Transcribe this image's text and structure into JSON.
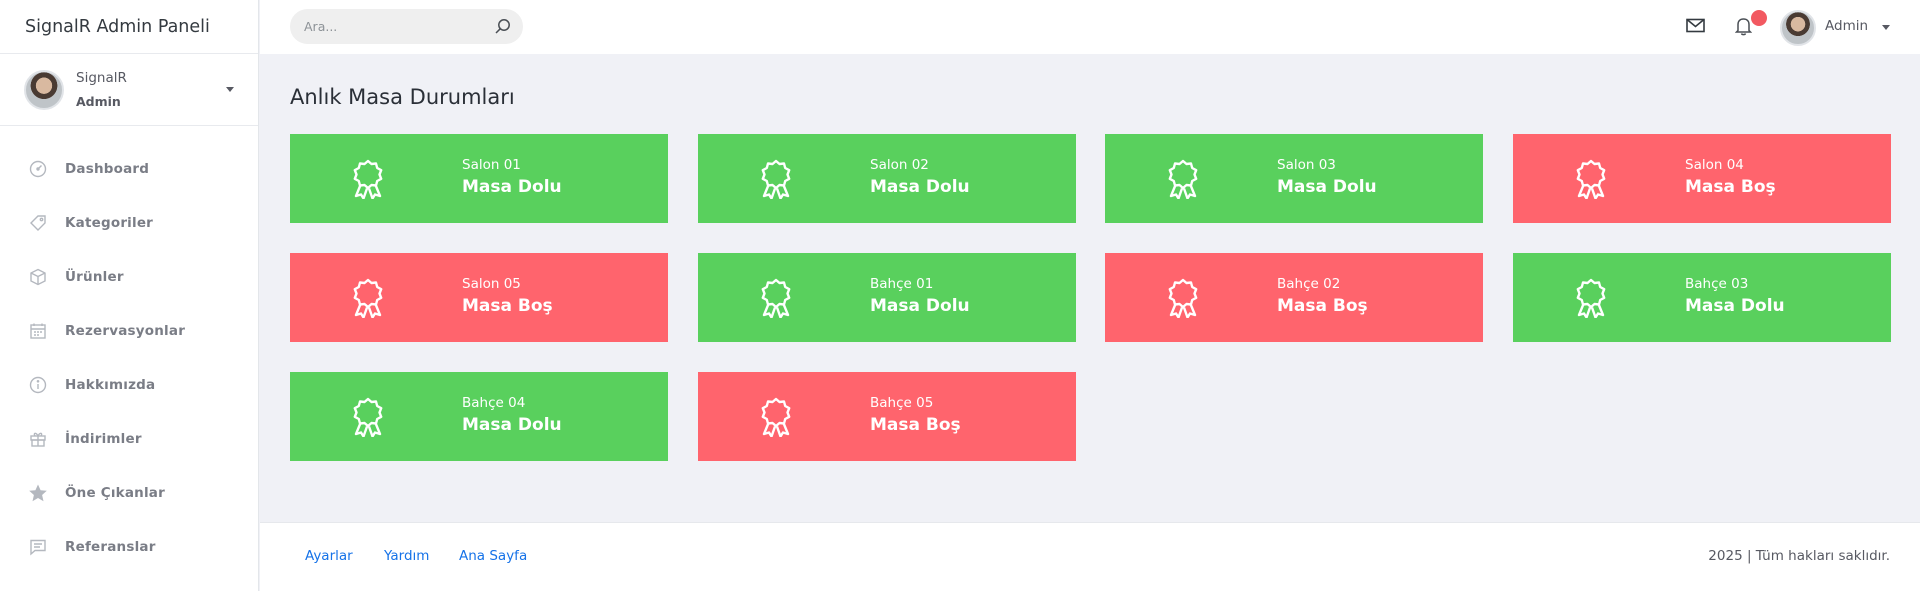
{
  "app": {
    "title": "SignalR Admin Paneli"
  },
  "sidebar": {
    "user": {
      "name": "SignalR",
      "role": "Admin"
    },
    "items": [
      {
        "label": "Dashboard",
        "icon": "dashboard-gauge-icon"
      },
      {
        "label": "Kategoriler",
        "icon": "tag-icon"
      },
      {
        "label": "Ürünler",
        "icon": "box-icon"
      },
      {
        "label": "Rezervasyonlar",
        "icon": "calendar-icon"
      },
      {
        "label": "Hakkımızda",
        "icon": "info-icon"
      },
      {
        "label": "İndirimler",
        "icon": "gift-icon"
      },
      {
        "label": "Öne Çıkanlar",
        "icon": "star-icon"
      },
      {
        "label": "Referanslar",
        "icon": "comment-icon"
      }
    ]
  },
  "header": {
    "search": {
      "placeholder": "Ara..."
    },
    "user": {
      "name": "Admin"
    }
  },
  "main": {
    "title": "Anlık Masa Durumları",
    "tables": [
      {
        "name": "Salon 01",
        "status": "Masa Dolu",
        "state": "dolu",
        "color": "#59d05d"
      },
      {
        "name": "Salon 02",
        "status": "Masa Dolu",
        "state": "dolu",
        "color": "#59d05d"
      },
      {
        "name": "Salon 03",
        "status": "Masa Dolu",
        "state": "dolu",
        "color": "#59d05d"
      },
      {
        "name": "Salon 04",
        "status": "Masa Boş",
        "state": "bos",
        "color": "#ff646d"
      },
      {
        "name": "Salon 05",
        "status": "Masa Boş",
        "state": "bos",
        "color": "#ff646d"
      },
      {
        "name": "Bahçe 01",
        "status": "Masa Dolu",
        "state": "dolu",
        "color": "#59d05d"
      },
      {
        "name": "Bahçe 02",
        "status": "Masa Boş",
        "state": "bos",
        "color": "#ff646d"
      },
      {
        "name": "Bahçe 03",
        "status": "Masa Dolu",
        "state": "dolu",
        "color": "#59d05d"
      },
      {
        "name": "Bahçe 04",
        "status": "Masa Dolu",
        "state": "dolu",
        "color": "#59d05d"
      },
      {
        "name": "Bahçe 05",
        "status": "Masa Boş",
        "state": "bos",
        "color": "#ff646d"
      }
    ]
  },
  "footer": {
    "links": [
      {
        "label": "Ayarlar"
      },
      {
        "label": "Yardım"
      },
      {
        "label": "Ana Sayfa"
      }
    ],
    "copyright": "2025 | Tüm hakları saklıdır."
  }
}
